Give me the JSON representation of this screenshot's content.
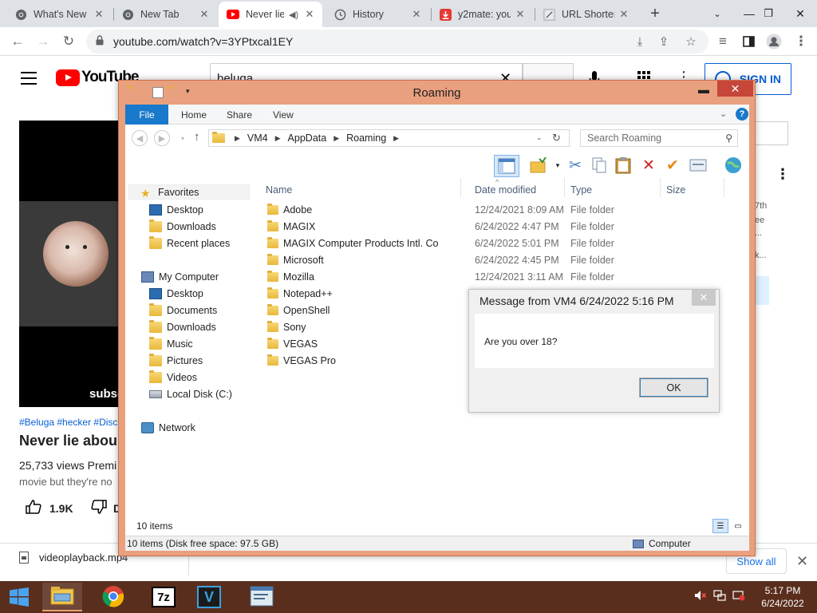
{
  "browser": {
    "tabs": [
      {
        "title": "What's New",
        "icon": "chrome-icon"
      },
      {
        "title": "New Tab",
        "icon": "chrome-icon"
      },
      {
        "title": "Never lie",
        "icon": "youtube-icon"
      },
      {
        "title": "History",
        "icon": "history-icon"
      },
      {
        "title": "y2mate: you",
        "icon": "y2mate-icon"
      },
      {
        "title": "URL Shorten",
        "icon": "link-icon"
      }
    ],
    "url": "youtube.com/watch?v=3YPtxcal1EY"
  },
  "youtube": {
    "logo_text": "YouTube",
    "search_value": "beluga",
    "signin_label": "SIGN IN",
    "video_overlay": "subsc",
    "tags": "#Beluga #hecker #Disc",
    "title": "Never lie abou",
    "views": "25,733 views  Premi",
    "description": "movie but they're no",
    "likes": "1.9K",
    "dislike_label": "D",
    "side_text": [
      "7th",
      "ee",
      "...",
      "k..."
    ]
  },
  "download_bar": {
    "filename": "videoplayback.mp4",
    "show_all": "Show all"
  },
  "explorer": {
    "title": "Roaming",
    "ribbon_tabs": [
      "File",
      "Home",
      "Share",
      "View"
    ],
    "breadcrumb": [
      "VM4",
      "AppData",
      "Roaming"
    ],
    "search_placeholder": "Search Roaming",
    "nav_pane": {
      "favorites": "Favorites",
      "favorites_items": [
        "Desktop",
        "Downloads",
        "Recent places"
      ],
      "computer": "My Computer",
      "computer_items": [
        "Desktop",
        "Documents",
        "Downloads",
        "Music",
        "Pictures",
        "Videos",
        "Local Disk (C:)"
      ],
      "network": "Network"
    },
    "columns": [
      "Name",
      "Date modified",
      "Type",
      "Size"
    ],
    "files": [
      {
        "name": "Adobe",
        "date": "12/24/2021 8:09 AM",
        "type": "File folder"
      },
      {
        "name": "MAGIX",
        "date": "6/24/2022 4:47 PM",
        "type": "File folder"
      },
      {
        "name": "MAGIX Computer Products Intl. Co",
        "date": "6/24/2022 5:01 PM",
        "type": "File folder"
      },
      {
        "name": "Microsoft",
        "date": "6/24/2022 4:45 PM",
        "type": "File folder"
      },
      {
        "name": "Mozilla",
        "date": "12/24/2021 3:11 AM",
        "type": "File folder"
      },
      {
        "name": "Notepad++",
        "date": "",
        "type": ""
      },
      {
        "name": "OpenShell",
        "date": "",
        "type": ""
      },
      {
        "name": "Sony",
        "date": "",
        "type": ""
      },
      {
        "name": "VEGAS",
        "date": "",
        "type": ""
      },
      {
        "name": "VEGAS Pro",
        "date": "",
        "type": ""
      }
    ],
    "item_count": "10 items",
    "status_left": "10 items (Disk free space: 97.5 GB)",
    "status_right": "Computer",
    "colors": {
      "frame": "#e9a07e",
      "file_tab": "#1979ca",
      "close": "#c7463a"
    }
  },
  "dialog": {
    "title": "Message from VM4 6/24/2022 5:16 PM",
    "message": "Are you over 18?",
    "ok_label": "OK"
  },
  "taskbar": {
    "apps": [
      "file-explorer-icon",
      "chrome-icon",
      "7zip-icon",
      "vegas-icon",
      "notepad-icon"
    ],
    "seven_zip_label": "7z",
    "vegas_label": "V",
    "time": "5:17 PM",
    "date": "6/24/2022",
    "color": "#5a2e1d"
  }
}
